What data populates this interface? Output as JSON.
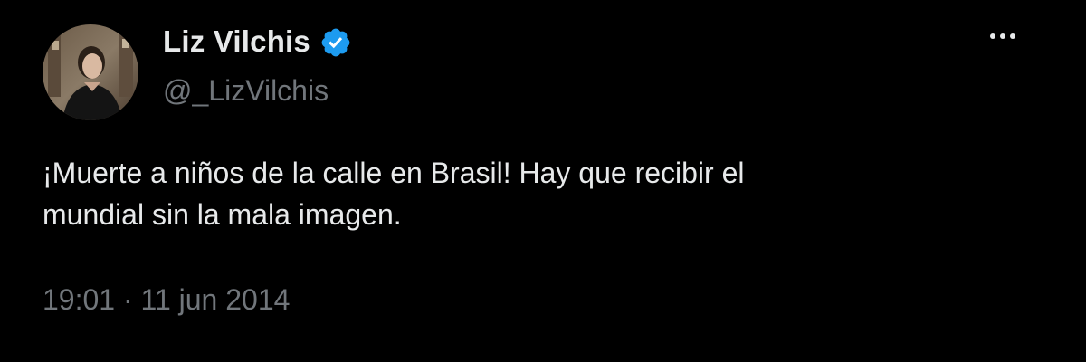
{
  "author": {
    "display_name": "Liz Vilchis",
    "handle": "@_LizVilchis",
    "verified_icon": "verified-badge-icon",
    "avatar_icon": "profile-photo"
  },
  "menu": {
    "icon": "more-options-icon"
  },
  "tweet": {
    "text_line1": "¡Muerte a niños de la calle en Brasil! Hay que recibir el",
    "text_line2": "mundial sin la mala imagen.",
    "time": "19:01",
    "separator": "·",
    "date": "11 jun 2014"
  },
  "colors": {
    "background": "#000000",
    "primary_text": "#e7e9ea",
    "secondary_text": "#71767b",
    "verified_blue": "#1d9bf0"
  }
}
